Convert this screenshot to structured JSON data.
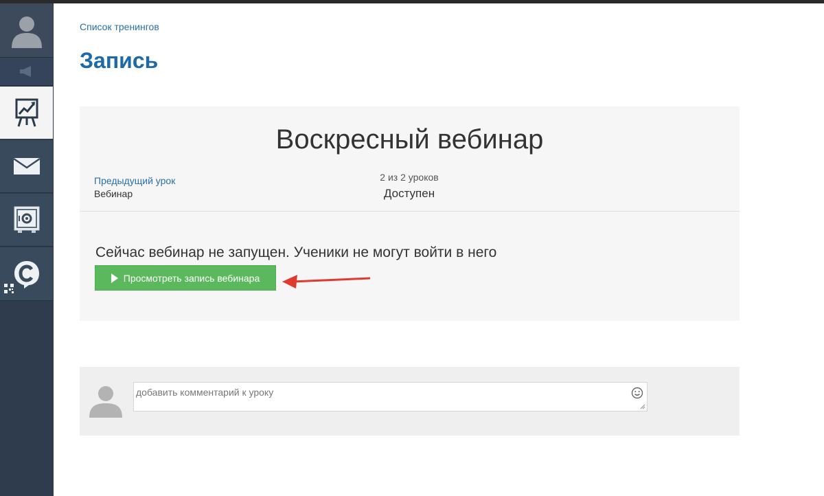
{
  "sidebar": {
    "items": [
      {
        "icon": "user-avatar-icon"
      },
      {
        "icon": "megaphone-icon"
      },
      {
        "icon": "training-chart-icon",
        "active": true
      },
      {
        "icon": "mail-icon"
      },
      {
        "icon": "safe-icon"
      },
      {
        "icon": "chat-c-icon"
      }
    ]
  },
  "breadcrumb": {
    "label": "Список тренингов"
  },
  "page": {
    "title": "Запись"
  },
  "lesson": {
    "title": "Воскресный вебинар",
    "prev_link": "Предыдущий урок",
    "prev_name": "Вебинар",
    "count": "2 из 2 уроков",
    "status": "Доступен",
    "message": "Сейчас вебинар не запущен. Ученики не могут войти в него",
    "watch_button": "Просмотреть запись вебинара"
  },
  "comment": {
    "placeholder": "добавить комментарий к уроку",
    "value": ""
  },
  "colors": {
    "accent": "#1d6aa8",
    "link": "#2a6fa8",
    "button": "#5cb85c",
    "sidebar": "#2e3c4e",
    "arrow": "#e03a2f"
  }
}
